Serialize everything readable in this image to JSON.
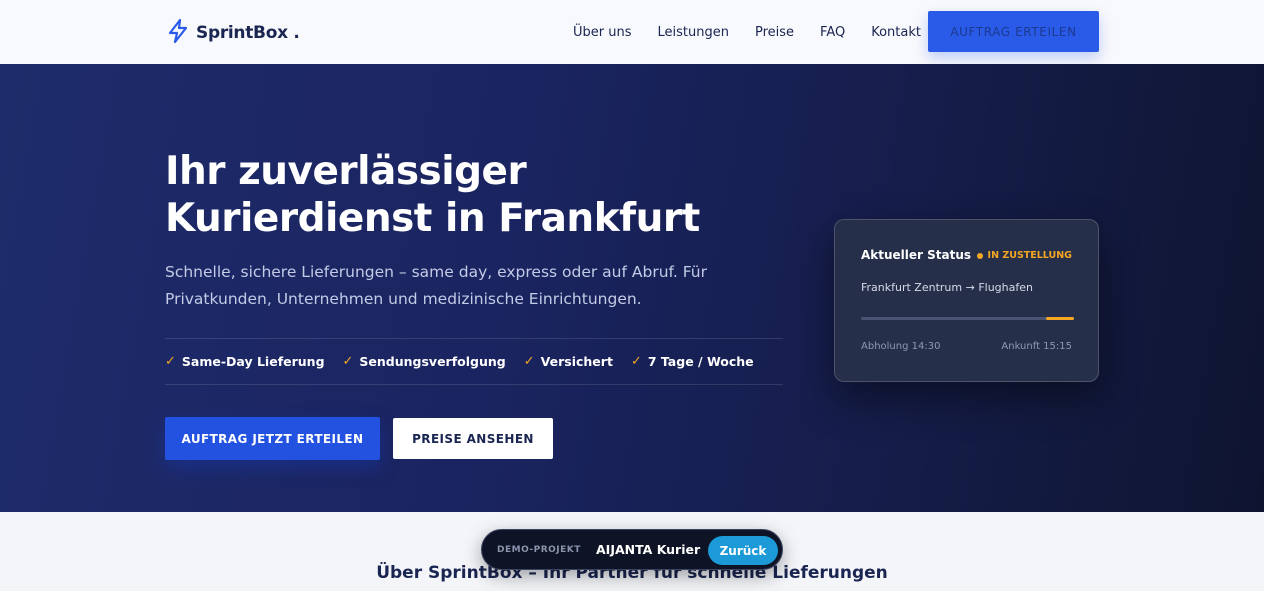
{
  "header": {
    "logo_text": "SprintBox .",
    "nav": [
      "Über uns",
      "Leistungen",
      "Preise",
      "FAQ",
      "Kontakt"
    ],
    "cta_label": "AUFTRAG ERTEILEN"
  },
  "hero": {
    "title_line1": "Ihr zuverlässiger",
    "title_line2": "Kurierdienst in Frankfurt",
    "subtitle_line1": "Schnelle, sichere Lieferungen – same day, express oder auf Abruf. Für",
    "subtitle_line2": "Privatkunden, Unternehmen und medizinische Einrichtungen.",
    "features": [
      "Same-Day Lieferung",
      "Sendungsverfolgung",
      "Versichert",
      "7 Tage / Woche"
    ],
    "primary_button": "AUFTRAG JETZT ERTEILEN",
    "secondary_button": "PREISE ANSEHEN"
  },
  "status_card": {
    "title": "Aktueller Status",
    "badge": "IN ZUSTELLUNG",
    "route": "Frankfurt Zentrum → Flughafen",
    "progress_fraction": 0.13,
    "pickup": "Abholung 14:30",
    "arrival": "Ankunft 15:15"
  },
  "section": {
    "title": "Über SprintBox – Ihr Partner für schnelle Lieferungen"
  },
  "demo_bar": {
    "label": "DEMO-PROJEKT",
    "name": "AIJANTA Kurier",
    "back_label": "Zurück"
  },
  "colors": {
    "accent_blue": "#2452e0",
    "highlight_orange": "#f5a623",
    "navy": "#1a2551"
  }
}
